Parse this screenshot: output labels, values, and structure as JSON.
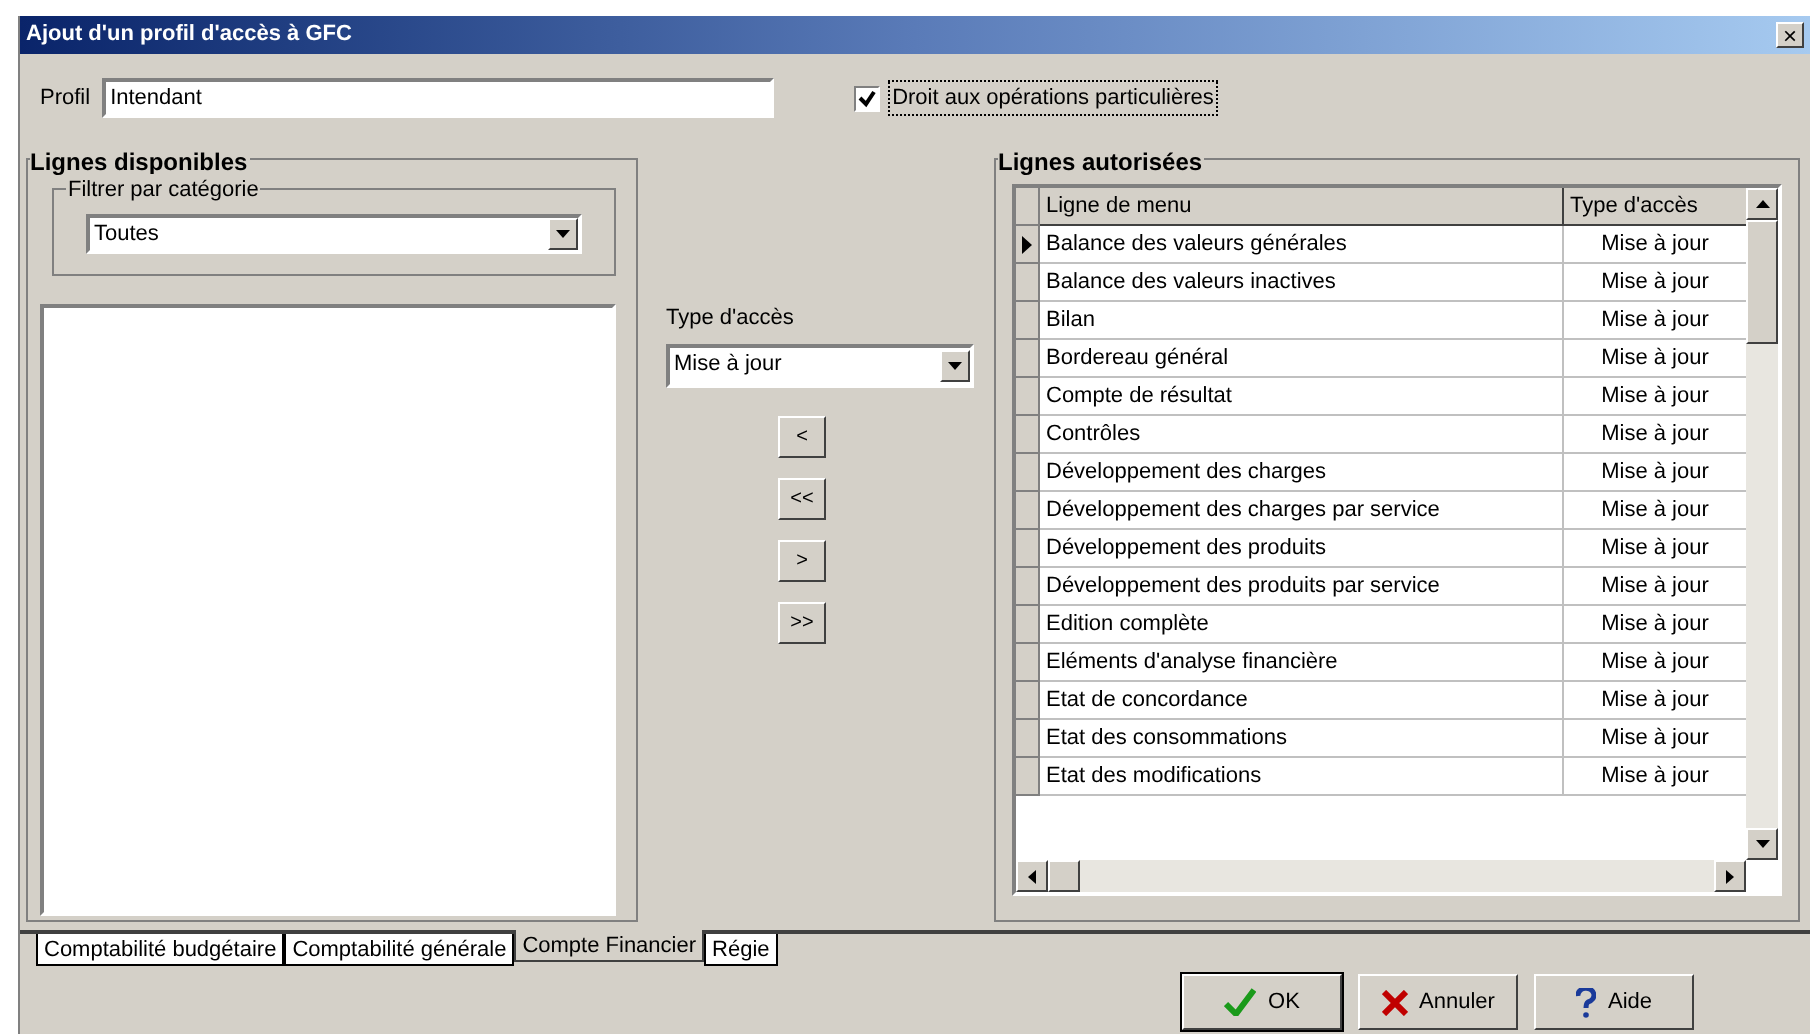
{
  "window": {
    "title": "Ajout d'un profil d'accès à GFC",
    "close": "×"
  },
  "profile": {
    "label": "Profil",
    "value": "Intendant"
  },
  "special_rights": {
    "label": "Droit aux opérations particulières",
    "checked": true
  },
  "available": {
    "title": "Lignes disponibles",
    "filter": {
      "title": "Filtrer par catégorie",
      "value": "Toutes"
    }
  },
  "access_type": {
    "label": "Type d'accès",
    "value": "Mise à jour"
  },
  "move_buttons": [
    "<",
    "<<",
    ">",
    ">>"
  ],
  "authorized": {
    "title": "Lignes autorisées",
    "columns": [
      "Ligne de menu",
      "Type d'accès"
    ],
    "rows": [
      {
        "name": "Balance des valeurs générales",
        "access": "Mise à jour",
        "selected": true
      },
      {
        "name": "Balance des valeurs inactives",
        "access": "Mise à jour",
        "selected": false
      },
      {
        "name": "Bilan",
        "access": "Mise à jour",
        "selected": false
      },
      {
        "name": "Bordereau général",
        "access": "Mise à jour",
        "selected": false
      },
      {
        "name": "Compte de résultat",
        "access": "Mise à jour",
        "selected": false
      },
      {
        "name": "Contrôles",
        "access": "Mise à jour",
        "selected": false
      },
      {
        "name": "Développement des charges",
        "access": "Mise à jour",
        "selected": false
      },
      {
        "name": "Développement des charges par service",
        "access": "Mise à jour",
        "selected": false
      },
      {
        "name": "Développement des produits",
        "access": "Mise à jour",
        "selected": false
      },
      {
        "name": "Développement des produits par service",
        "access": "Mise à jour",
        "selected": false
      },
      {
        "name": "Edition complète",
        "access": "Mise à jour",
        "selected": false
      },
      {
        "name": "Eléments d'analyse financière",
        "access": "Mise à jour",
        "selected": false
      },
      {
        "name": "Etat de concordance",
        "access": "Mise à jour",
        "selected": false
      },
      {
        "name": "Etat des consommations",
        "access": "Mise à jour",
        "selected": false
      },
      {
        "name": "Etat des modifications",
        "access": "Mise à jour",
        "selected": false
      }
    ]
  },
  "tabs": [
    {
      "label": "Comptabilité budgétaire",
      "selected": false
    },
    {
      "label": "Comptabilité générale",
      "selected": false
    },
    {
      "label": "Compte Financier",
      "selected": true
    },
    {
      "label": "Régie",
      "selected": false
    }
  ],
  "buttons": [
    {
      "kind": "ok",
      "label": "OK"
    },
    {
      "kind": "cancel",
      "label": "Annuler"
    },
    {
      "kind": "help",
      "label": "Aide"
    }
  ]
}
